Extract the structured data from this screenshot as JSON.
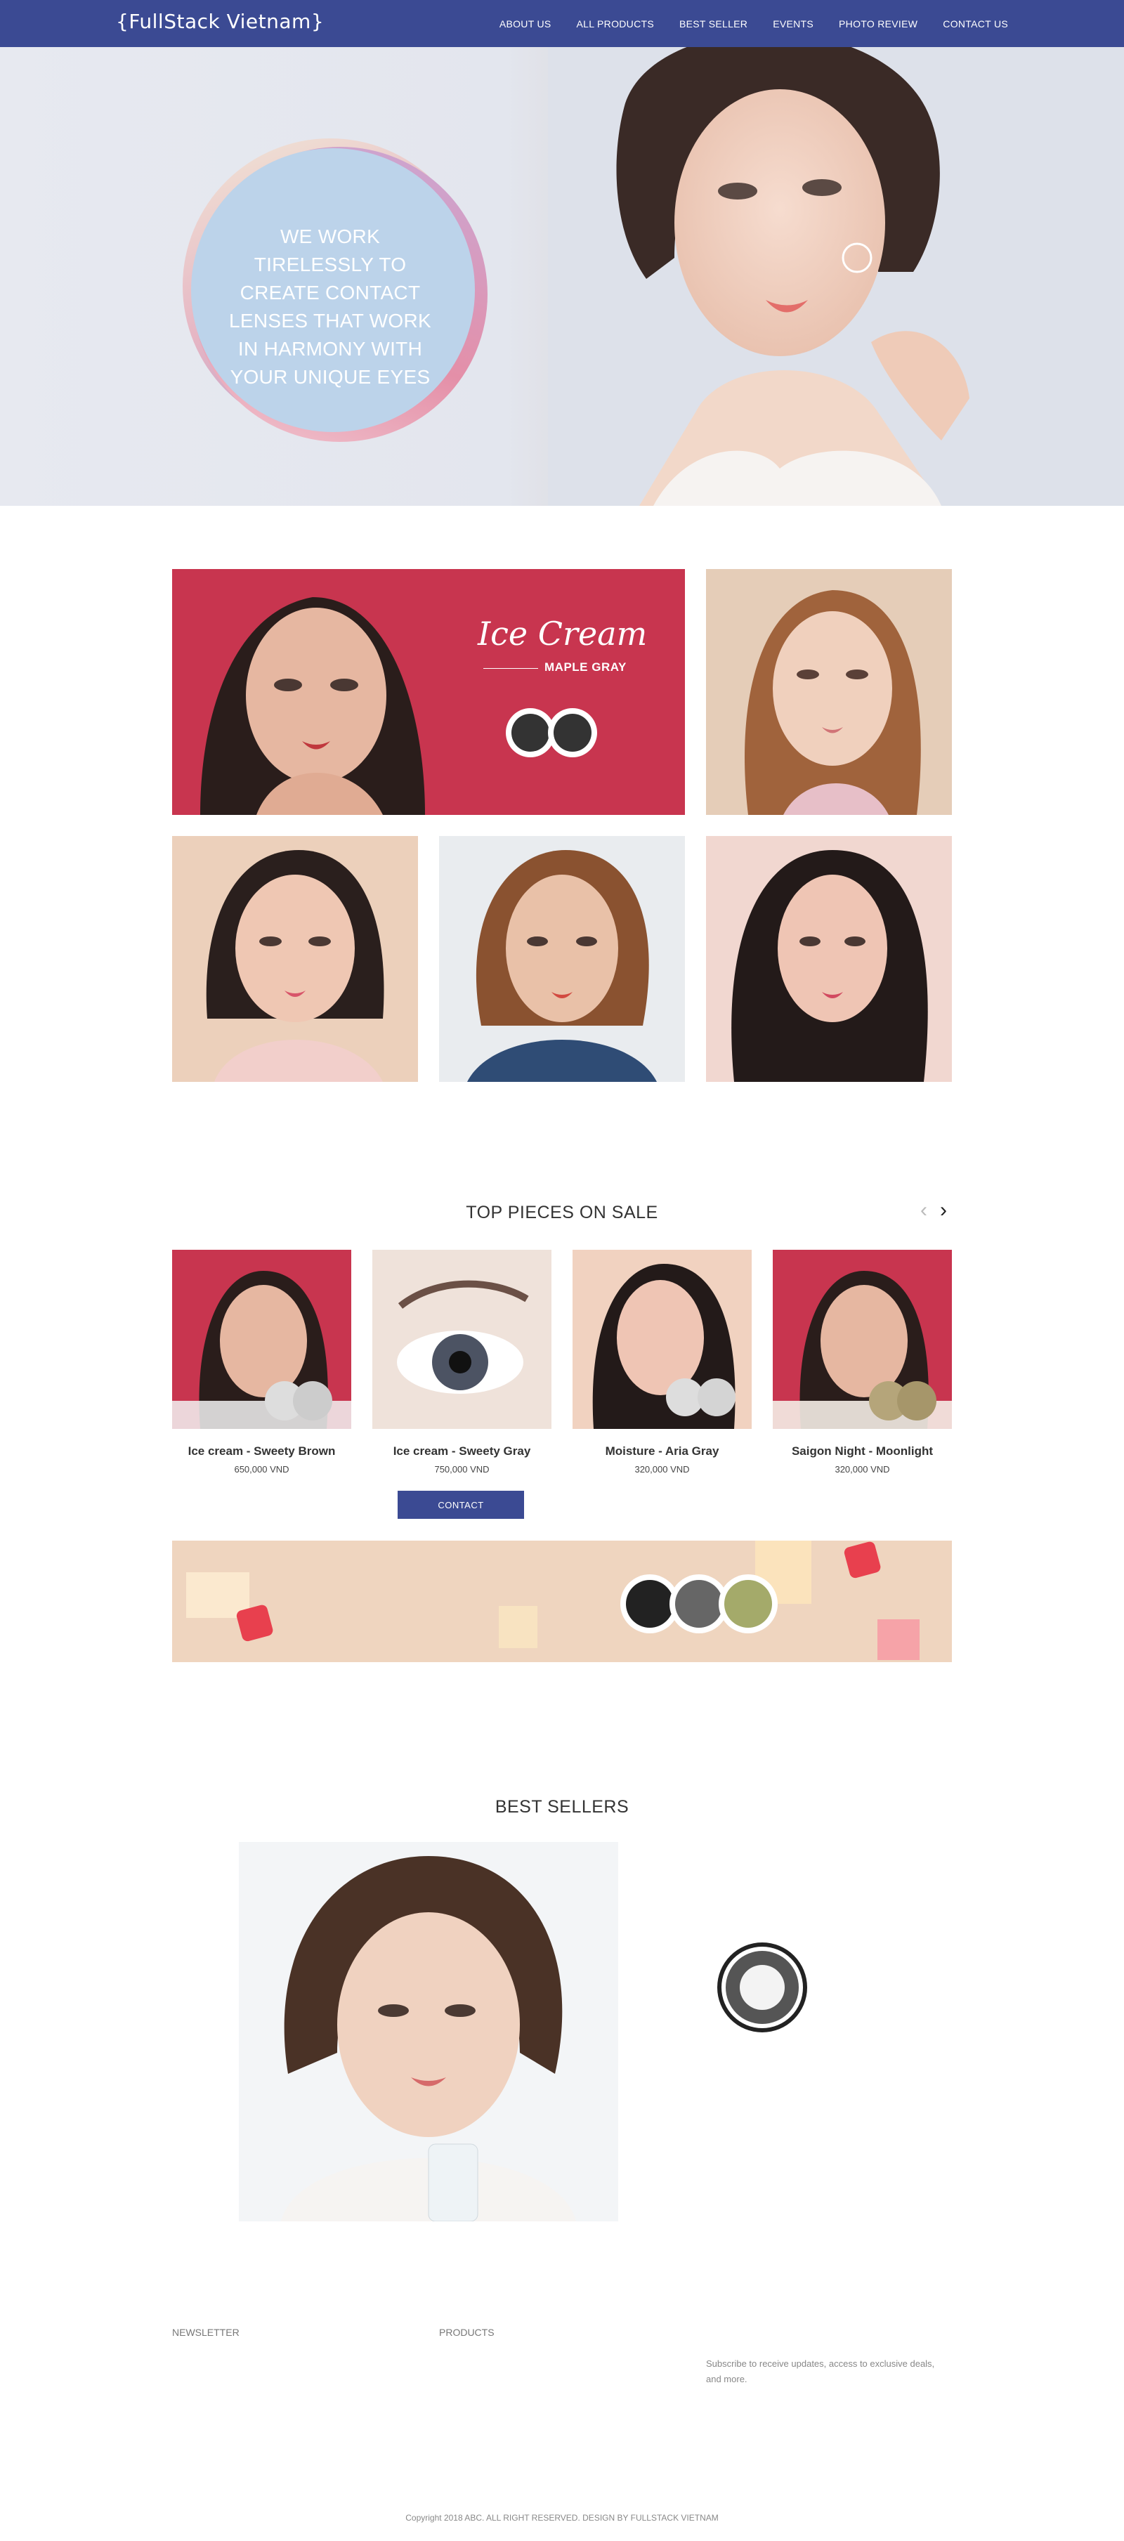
{
  "nav": {
    "logo": "{FullStack Vietnam}",
    "items": [
      "ABOUT US",
      "ALL PRODUCTS",
      "BEST SELLER",
      "EVENTS",
      "PHOTO REVIEW",
      "CONTACT US"
    ]
  },
  "hero": {
    "tagline": "WE WORK TIRELESSLY TO CREATE CONTACT LENSES THAT WORK IN HARMONY WITH YOUR UNIQUE EYES"
  },
  "gallery": {
    "feature_title": "Ice Cream",
    "feature_subtitle": "MAPLE GRAY"
  },
  "top_pieces": {
    "title": "TOP PIECES ON SALE",
    "contact_label": "CONTACT",
    "products": [
      {
        "name": "Ice cream - Sweety Brown",
        "price": "650,000 VND"
      },
      {
        "name": "Ice cream - Sweety Gray",
        "price": "750,000 VND"
      },
      {
        "name": "Moisture - Aria Gray",
        "price": "320,000 VND"
      },
      {
        "name": "Saigon Night - Moonlight",
        "price": "320,000 VND"
      }
    ]
  },
  "best_sellers": {
    "title": "BEST SELLERS"
  },
  "footer": {
    "newsletter_label": "NEWSLETTER",
    "products_label": "PRODUCTS",
    "subscribe_text": "Subscribe to receive updates, access to exclusive deals, and more.",
    "copyright": "Copyright 2018 ABC. ALL RIGHT RESERVED. DESIGN BY FULLSTACK VIETNAM"
  },
  "colors": {
    "nav_bg": "#3b4a93",
    "accent_red": "#c8354f",
    "banner_bg": "#efd5bf"
  }
}
